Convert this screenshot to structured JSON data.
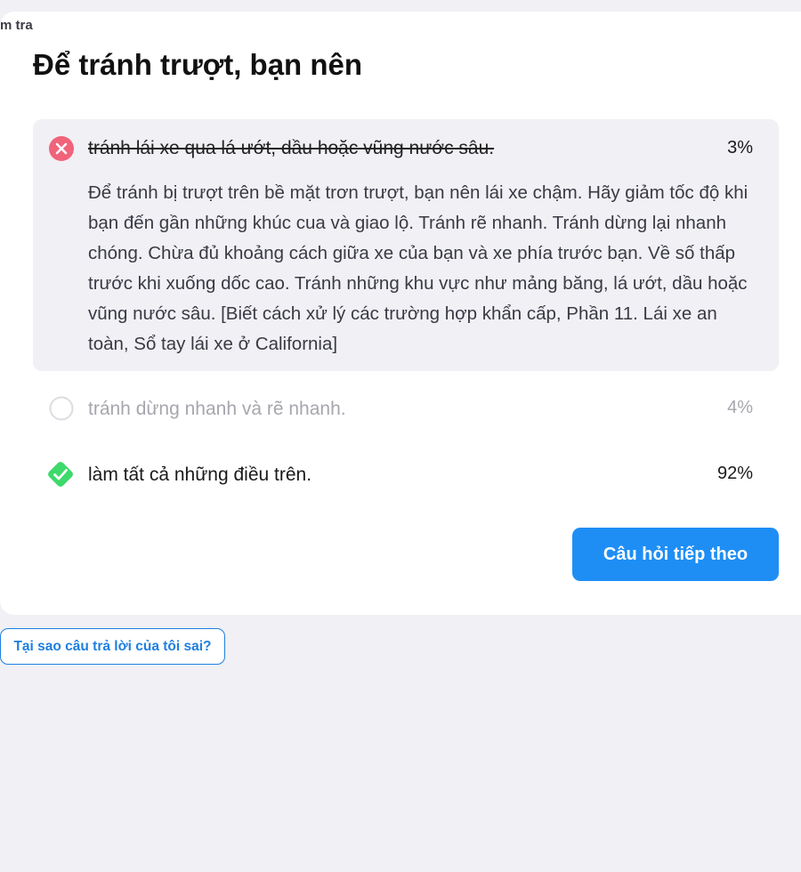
{
  "breadcrumb": "m tra",
  "question": "Để tránh trượt, bạn nên",
  "options": [
    {
      "text": "tránh lái xe qua lá ướt, dầu hoặc vũng nước sâu.",
      "percent": "3%",
      "status": "incorrect-selected",
      "icon": "x-circle-icon"
    },
    {
      "text": "tránh dừng nhanh và rẽ nhanh.",
      "percent": "4%",
      "status": "unselected",
      "icon": "empty-circle-icon"
    },
    {
      "text": "làm tất cả những điều trên.",
      "percent": "92%",
      "status": "correct",
      "icon": "check-diamond-icon"
    }
  ],
  "explanation": "Để tránh bị trượt trên bề mặt trơn trượt, bạn nên lái xe chậm. Hãy giảm tốc độ khi bạn đến gần những khúc cua và giao lộ. Tránh rẽ nhanh. Tránh dừng lại nhanh chóng. Chừa đủ khoảng cách giữa xe của bạn và xe phía trước bạn. Về số thấp trước khi xuống dốc cao. Tránh những khu vực như mảng băng, lá ướt, dầu hoặc vũng nước sâu. [Biết cách xử lý các trường hợp khẩn cấp, Phần 11. Lái xe an toàn, Sổ tay lái xe ở California]",
  "next_button": "Câu hỏi tiếp theo",
  "why_button": "Tại sao câu trả lời của tôi sai?",
  "colors": {
    "background": "#f0f0f5",
    "card": "#ffffff",
    "wrong": "#f0637a",
    "correct": "#3dd96a",
    "accent": "#1e8ef5"
  }
}
